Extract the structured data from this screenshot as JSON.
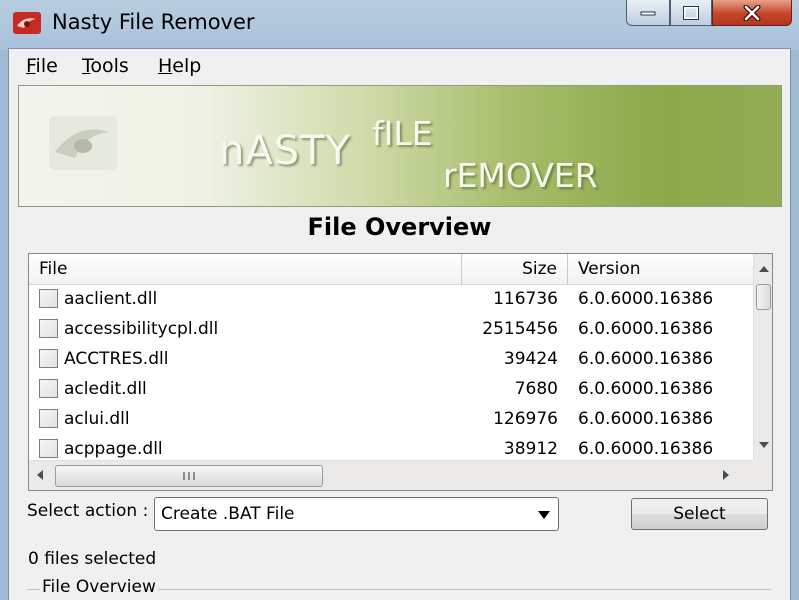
{
  "window": {
    "title": "Nasty File Remover"
  },
  "menu": {
    "items": [
      {
        "id": "file",
        "underline": "F",
        "rest": "ile"
      },
      {
        "id": "tools",
        "underline": "T",
        "rest": "ools"
      },
      {
        "id": "help",
        "underline": "H",
        "rest": "elp"
      }
    ]
  },
  "banner": {
    "word1": "nASTY",
    "word2": "fILE",
    "word3": "rEMOVER"
  },
  "section": {
    "title": "File Overview"
  },
  "list": {
    "columns": {
      "file": "File",
      "size": "Size",
      "version": "Version"
    },
    "rows": [
      {
        "name": "aaclient.dll",
        "size": "116736",
        "version": "6.0.6000.16386",
        "checked": false
      },
      {
        "name": "accessibilitycpl.dll",
        "size": "2515456",
        "version": "6.0.6000.16386",
        "checked": false
      },
      {
        "name": "ACCTRES.dll",
        "size": "39424",
        "version": "6.0.6000.16386",
        "checked": false
      },
      {
        "name": "acledit.dll",
        "size": "7680",
        "version": "6.0.6000.16386",
        "checked": false
      },
      {
        "name": "aclui.dll",
        "size": "126976",
        "version": "6.0.6000.16386",
        "checked": false
      },
      {
        "name": "acppage.dll",
        "size": "38912",
        "version": "6.0.6000.16386",
        "checked": false
      }
    ]
  },
  "action": {
    "label": "Select action :",
    "value": "Create .BAT File",
    "button": "Select"
  },
  "status": {
    "text": "0 files selected"
  },
  "group": {
    "label": "File Overview"
  },
  "colors": {
    "banner_green": "#8ba84a",
    "close_red": "#c4452b",
    "window_frame": "#a9c2da"
  }
}
